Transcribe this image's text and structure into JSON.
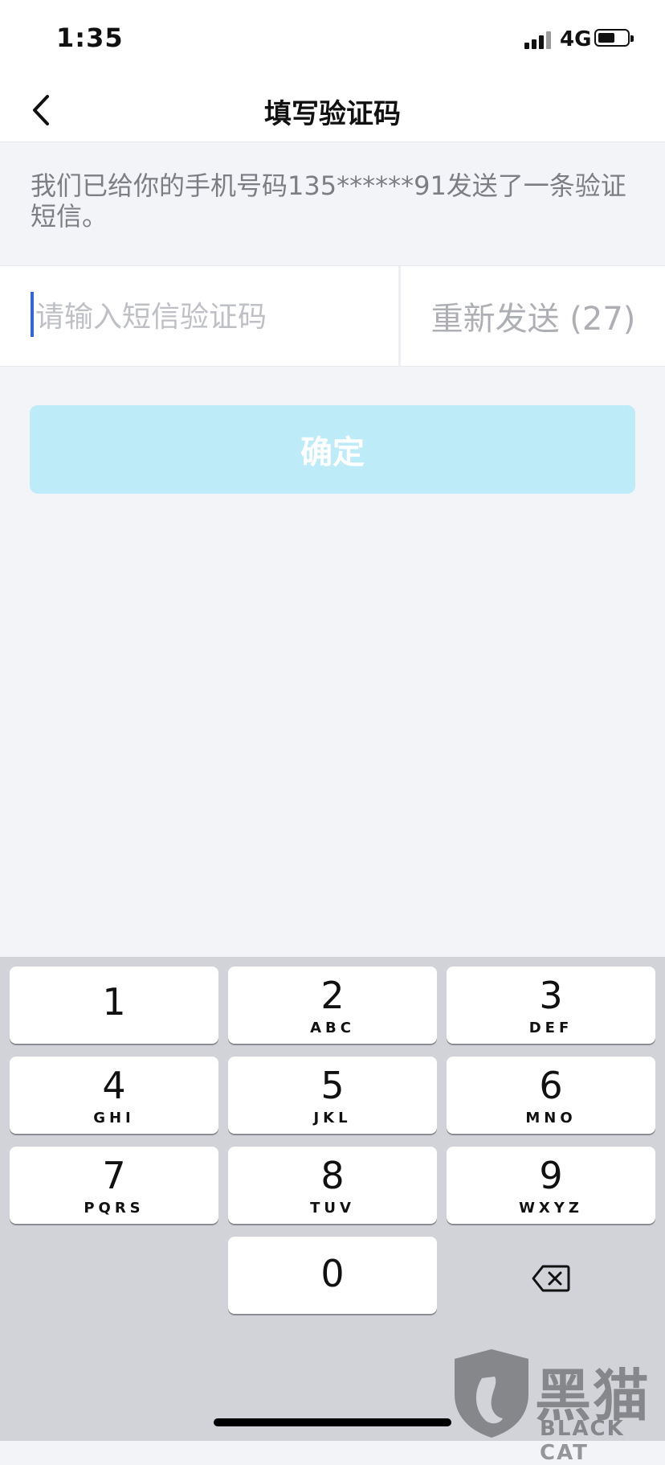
{
  "status_bar": {
    "time": "1:35",
    "network": "4G"
  },
  "nav": {
    "title": "填写验证码"
  },
  "info": {
    "text": "我们已给你的手机号码135******91发送了一条验证短信。"
  },
  "verification": {
    "placeholder": "请输入短信验证码",
    "resend_label": "重新发送 (27)"
  },
  "confirm": {
    "label": "确定"
  },
  "keypad": {
    "keys": [
      {
        "digit": "1",
        "letters": ""
      },
      {
        "digit": "2",
        "letters": "ABC"
      },
      {
        "digit": "3",
        "letters": "DEF"
      },
      {
        "digit": "4",
        "letters": "GHI"
      },
      {
        "digit": "5",
        "letters": "JKL"
      },
      {
        "digit": "6",
        "letters": "MNO"
      },
      {
        "digit": "7",
        "letters": "PQRS"
      },
      {
        "digit": "8",
        "letters": "TUV"
      },
      {
        "digit": "9",
        "letters": "WXYZ"
      },
      {
        "digit": "0",
        "letters": ""
      }
    ]
  },
  "watermark": {
    "title": "黑猫",
    "subtitle": "BLACK CAT"
  },
  "colors": {
    "accent_disabled": "#bdebf8",
    "cursor": "#3366dd",
    "background": "#f3f4f8",
    "keypad_background": "#d1d3d9"
  }
}
